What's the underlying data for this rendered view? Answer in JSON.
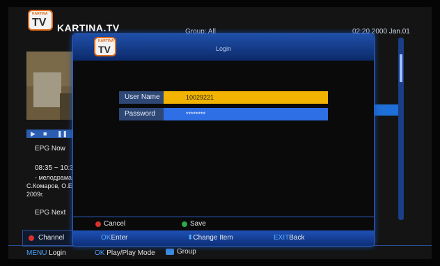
{
  "header": {
    "brand": "KARTINA.TV",
    "logo_small": "KARTINA",
    "logo_tv": "TV",
    "group": "Group: All",
    "clock": "02:20 2000 Jan.01"
  },
  "epg": {
    "now_label": "EPG Now",
    "time": "08:35 ~ 10:3",
    "line1": "- мелодрама",
    "line2": "С.Комаров, О.Е",
    "line3": "2009г.",
    "next_label": "EPG Next"
  },
  "bottom": {
    "channel": "Channel",
    "menu_key": "MENU",
    "menu_label": "Login",
    "ok_key": "OK",
    "ok_label": "Play/Play Mode",
    "group_label": "Group"
  },
  "dialog": {
    "title": "Login",
    "logo_small": "KARTINA",
    "logo_tv": "TV",
    "fields": [
      {
        "label": "User Name",
        "value": "10029221"
      },
      {
        "label": "Password",
        "value": "********"
      }
    ],
    "cancel": "Cancel",
    "save": "Save",
    "help": {
      "ok_key": "OK",
      "ok_label": "Enter",
      "change_label": "Change Item",
      "exit_key": "EXIT",
      "exit_label": "Back"
    }
  },
  "colors": {
    "accent_blue": "#1f6fd8",
    "user_field_yellow": "#f2b400",
    "password_field_blue": "#2f6fe6",
    "cancel_red": "#d9332b",
    "save_green": "#2ea84a"
  }
}
